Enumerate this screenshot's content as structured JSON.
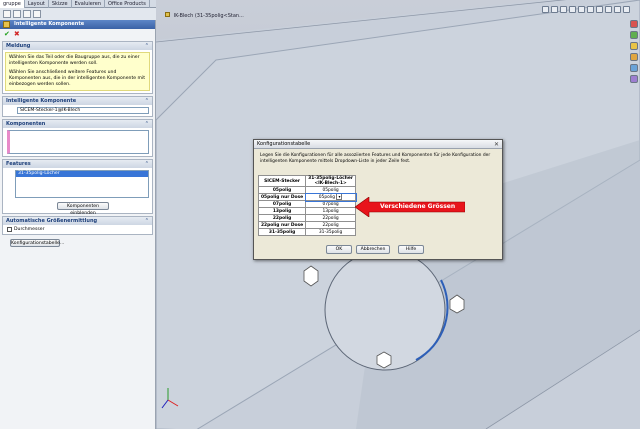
{
  "tabs": [
    "gruppe",
    "Layout",
    "Skizze",
    "Evaluieren",
    "Office Products"
  ],
  "pm": {
    "title": "Intelligente Komponente",
    "ok": "✔",
    "cancel": "✖",
    "sections": {
      "message": {
        "title": "Meldung",
        "text1": "Wählen Sie das Teil oder die Baugruppe aus, die zu einer intelligenten Komponente werden soll.",
        "text2": "Wählen Sie anschließend weitere Features und Komponenten aus, die in der intelligenten Komponente mit einbezogen werden sollen."
      },
      "smart": {
        "title": "Intelligente Komponente",
        "value": "SICEM-Stecker-1@IK-Blech"
      },
      "components": {
        "title": "Komponenten"
      },
      "features": {
        "title": "Features",
        "item": "31-35polig-Löcher",
        "button": "Komponenten einblenden"
      },
      "autosize": {
        "title": "Automatische Größenermittlung",
        "checkbox": "Durchmesser"
      },
      "config_button": "Konfigurationstabelle..."
    }
  },
  "graphics": {
    "tree_label": "IK-Blech (31-35polig<Stan..."
  },
  "dialog": {
    "title": "Konfigurationstabelle",
    "close": "✕",
    "intro": "Legen Sie die Konfigurationen für alle assoziierten Features und Komponenten für jede Konfiguration der intelligenten Komponente mittels Dropdown-Liste in jeder Zeile fest.",
    "col1": "SICEM-Stecker",
    "col2a": "31-35polig-Löcher",
    "col2b": "<IK-Blech-1>",
    "rows": [
      [
        "05polig",
        "05polig"
      ],
      [
        "05polig nur Dose",
        "05polig"
      ],
      [
        "07polig",
        "07polig"
      ],
      [
        "13polig",
        "13polig"
      ],
      [
        "22polig",
        "22polig"
      ],
      [
        "22polig nur Dose",
        "22polig"
      ],
      [
        "31-35polig",
        "31-35polig"
      ]
    ],
    "buttons": [
      "OK",
      "Abbrechen",
      "Hilfe"
    ]
  },
  "annotation": {
    "text": "Verschiedene Grössen",
    "color": "#e8141b"
  }
}
